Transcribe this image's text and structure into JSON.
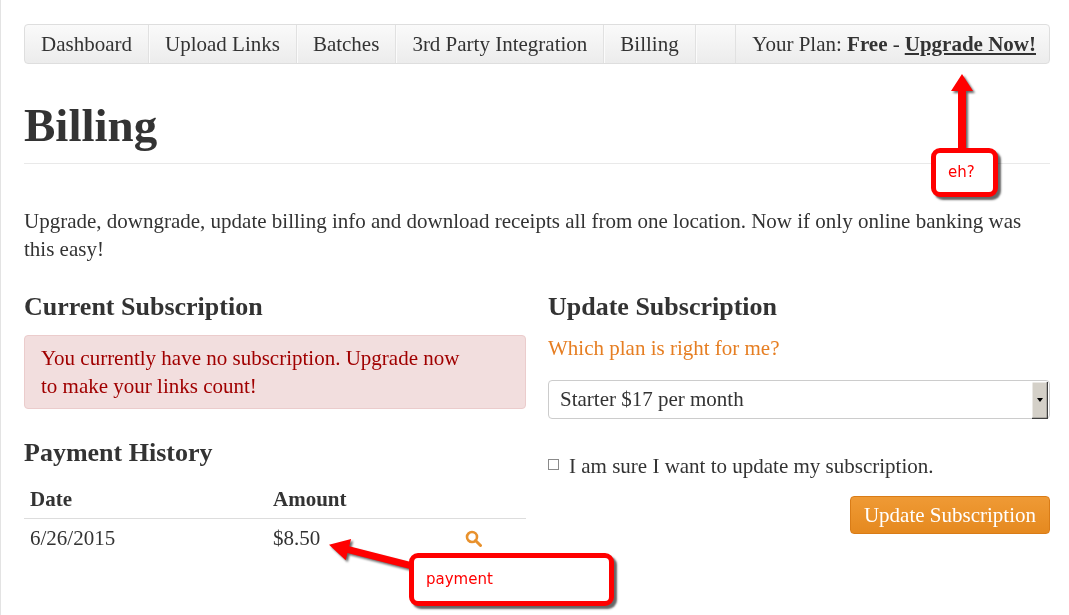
{
  "nav": {
    "links": [
      "Dashboard",
      "Upload Links",
      "Batches",
      "3rd Party Integration",
      "Billing"
    ],
    "plan": {
      "status": "Your Plan: **Free** -",
      "upgrade_link": "Upgrade Now!"
    }
  },
  "page": {
    "title": "Billing",
    "intro": "Upgrade, downgrade, update billing info and download receipts all from one location. Now if only online banking was this easy!"
  },
  "current_subscription": {
    "heading": "Current Subscription",
    "alert": "You currently have no subscription. Upgrade now to make your links count!"
  },
  "payment_history": {
    "heading": "Payment History",
    "columns": [
      "Date",
      "Amount"
    ],
    "rows": [
      {
        "date": "6/26/2015",
        "amount": "$8.50"
      }
    ]
  },
  "update_subscription": {
    "heading": "Update Subscription",
    "help_link": "Which plan is right for me?",
    "plan_select": {
      "value": "Starter $17 per month"
    },
    "confirm": {
      "label": "I am sure I want to update my subscription.",
      "checked": false
    },
    "button": "Update Subscription"
  },
  "annotations": [
    {
      "text": "eh?"
    },
    {
      "text": "payment"
    }
  ]
}
